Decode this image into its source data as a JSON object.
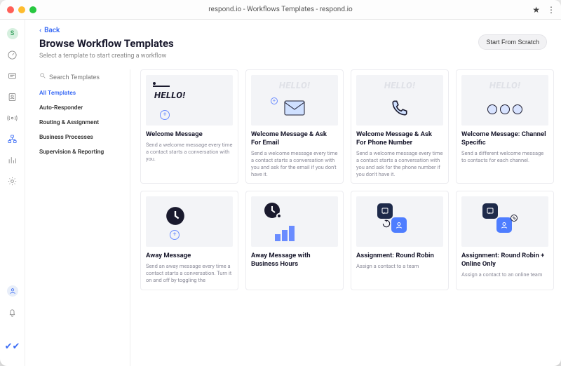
{
  "window": {
    "title": "respond.io - Workflows Templates - respond.io",
    "ext_icon": "★",
    "menu_icon": "⋮"
  },
  "back_label": "Back",
  "page_title": "Browse Workflow Templates",
  "page_subtitle": "Select a template to start creating a workflow",
  "scratch_label": "Start From Scratch",
  "search": {
    "placeholder": "Search Templates"
  },
  "categories": [
    {
      "label": "All Templates",
      "active": true
    },
    {
      "label": "Auto-Responder",
      "active": false
    },
    {
      "label": "Routing & Assignment",
      "active": false
    },
    {
      "label": "Business Processes",
      "active": false
    },
    {
      "label": "Supervision & Reporting",
      "active": false
    }
  ],
  "templates": [
    {
      "title": "Welcome Message",
      "desc": "Send a welcome message every time a contact starts a conversation with you.",
      "art": "hello1"
    },
    {
      "title": "Welcome Message & Ask For Email",
      "desc": "Send a welcome message every time a contact starts a conversation with you and ask for the email if you don't have it.",
      "art": "hello-mail"
    },
    {
      "title": "Welcome Message & Ask For Phone Number",
      "desc": "Send a welcome message every time a contact starts a conversation with you and ask for the phone number if you don't have it.",
      "art": "hello-phone"
    },
    {
      "title": "Welcome Message: Channel Specific",
      "desc": "Send a different welcome message to contacts for each channel.",
      "art": "hello-channels"
    },
    {
      "title": "Away Message",
      "desc": "Send an away message every time a contact starts a conversation. Turn it on and off by toggling the",
      "art": "away"
    },
    {
      "title": "Away Message with Business Hours",
      "desc": "",
      "art": "away-hours"
    },
    {
      "title": "Assignment: Round Robin",
      "desc": "Assign a contact to a team",
      "art": "robin"
    },
    {
      "title": "Assignment: Round Robin + Online Only",
      "desc": "Assign a contact to an online team",
      "art": "robin-online"
    }
  ],
  "iconrail": [
    "gauge",
    "chat",
    "contact",
    "broadcast",
    "workflow",
    "reports",
    "settings"
  ],
  "avatar_initial": "S"
}
